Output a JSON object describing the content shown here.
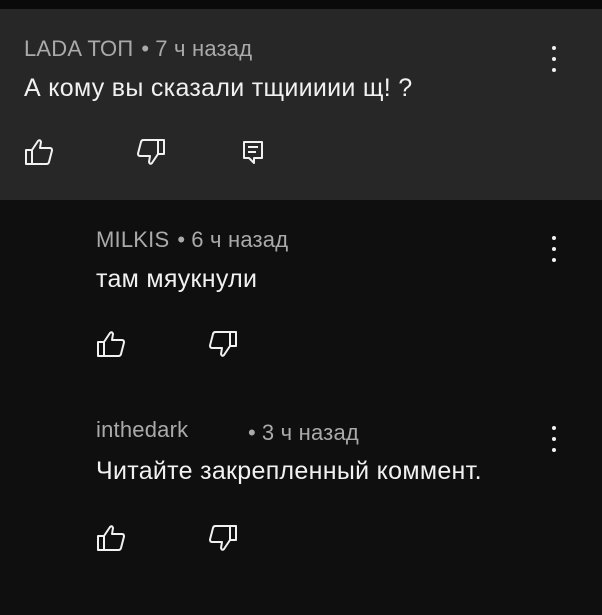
{
  "comments": [
    {
      "author": "LADA ТОП",
      "separator": "•",
      "time": "7 ч назад",
      "text": "А кому вы сказали тщиииии щ! ?"
    },
    {
      "author": "MILKIS",
      "separator": "•",
      "time": "6 ч назад",
      "text": "там мяукнули"
    },
    {
      "author": "inthedark",
      "separator": "•",
      "time": "3 ч назад",
      "text": "Читайте закрепленный коммент."
    }
  ],
  "icons": {
    "like": "thumbs-up-icon",
    "dislike": "thumbs-down-icon",
    "reply": "reply-icon",
    "more": "more-vertical-icon"
  },
  "colors": {
    "background": "#0f0f0f",
    "highlight": "#272727",
    "meta_text": "#aaaaaa",
    "body_text": "#f1f1f1"
  }
}
